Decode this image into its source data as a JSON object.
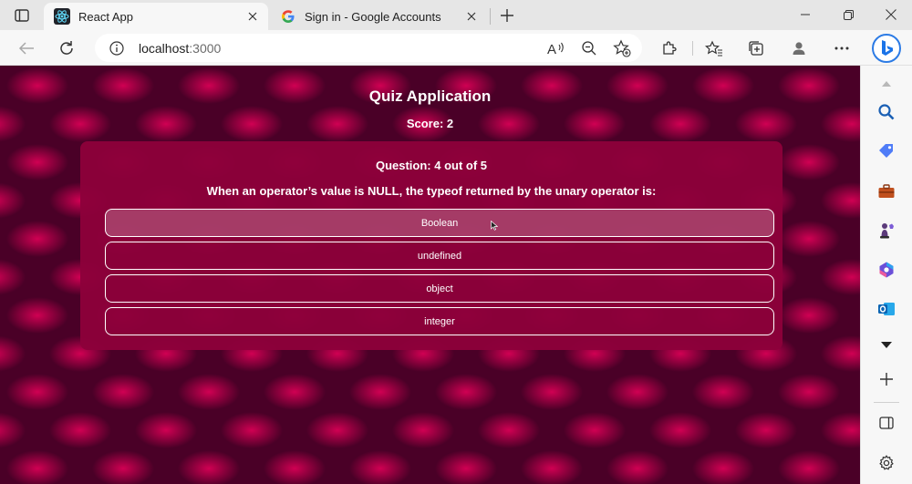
{
  "browser": {
    "tabs": [
      {
        "title": "React App",
        "icon": "react-icon"
      },
      {
        "title": "Sign in - Google Accounts",
        "icon": "google-icon"
      }
    ],
    "url_host": "localhost",
    "url_port": ":3000"
  },
  "app": {
    "title": "Quiz Application",
    "score": "Score: 2",
    "question_counter": "Question: 4 out of 5",
    "question": "When an operator’s value is NULL, the typeof returned by the unary operator is:",
    "answers": [
      "Boolean",
      "undefined",
      "object",
      "integer"
    ],
    "hovered_answer": "Boolean"
  },
  "colors": {
    "card": "#8c003a",
    "background_dark": "#4a0027",
    "background_light": "#d70055",
    "text": "#ffffff"
  }
}
